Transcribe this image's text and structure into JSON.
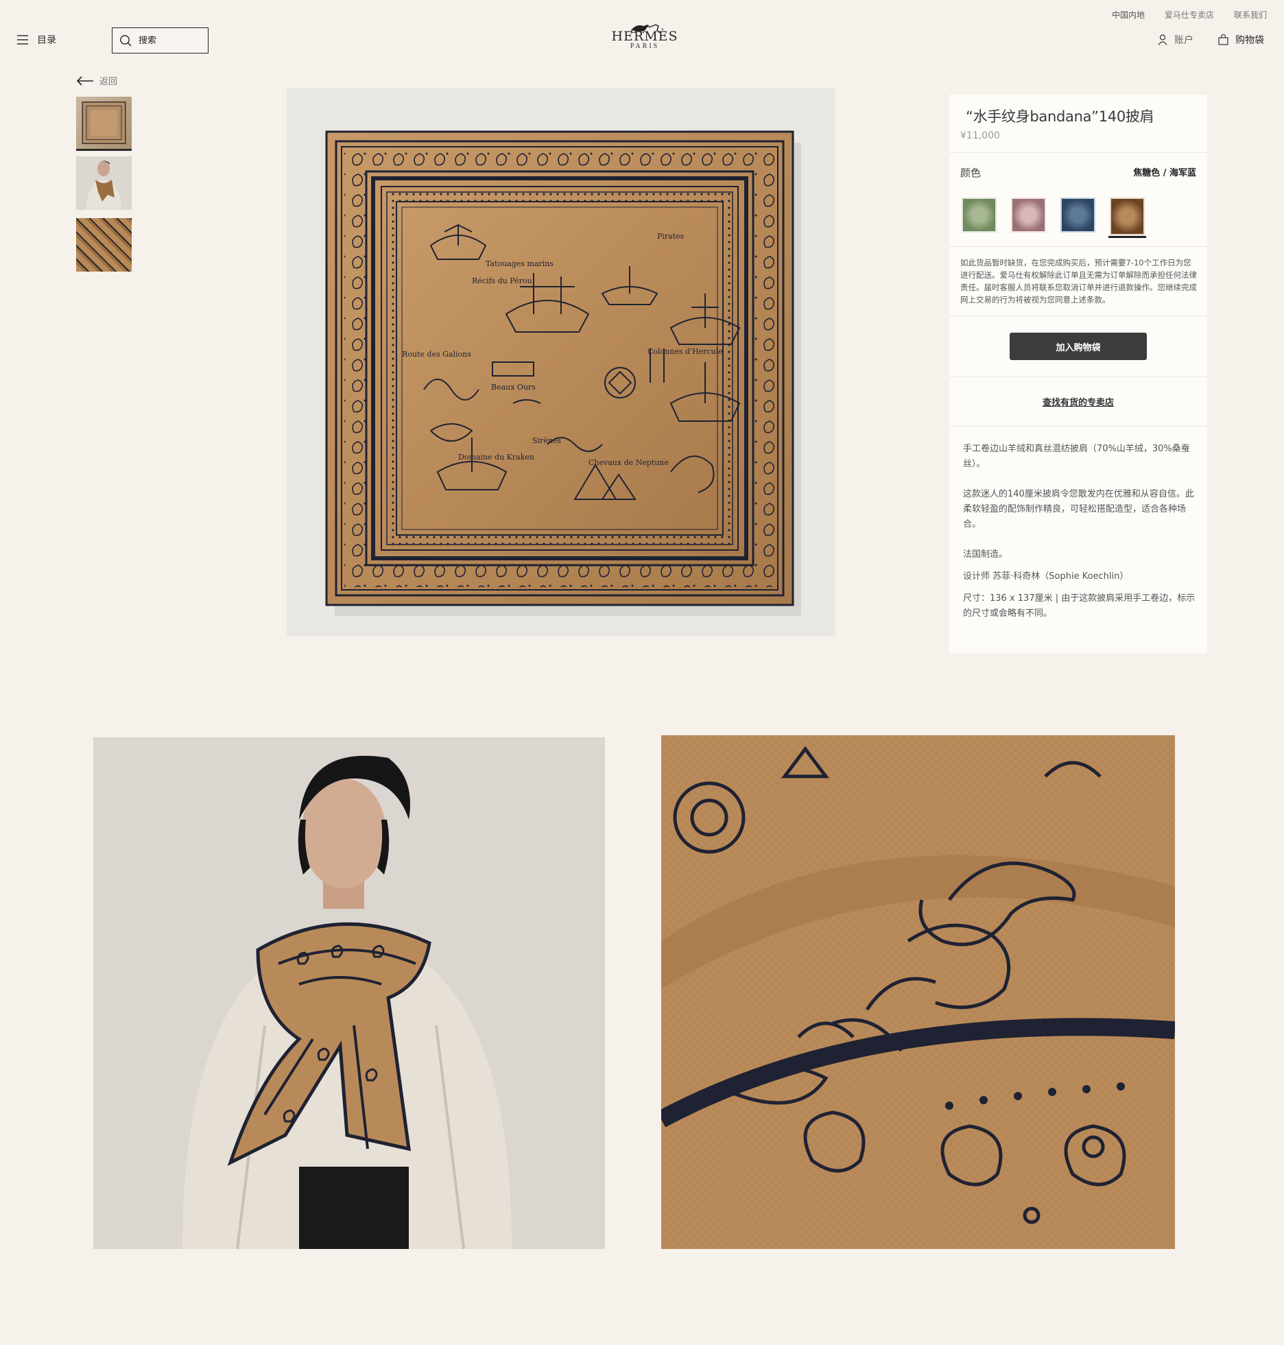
{
  "top_links": [
    "中国内地",
    "爱马仕专卖店",
    "联系我们"
  ],
  "header": {
    "menu_label": "目录",
    "search_placeholder": "搜索",
    "logo_word": "HERMÈS",
    "logo_sub": "PARIS",
    "account_label": "账户",
    "bag_label": "购物袋"
  },
  "nav": {
    "back_label": "返回"
  },
  "product": {
    "title": "“水手纹身bandana”140披肩",
    "price": "¥11,000",
    "color_label": "颜色",
    "color_value": "焦糖色 / 海军蓝",
    "swatch_colors": [
      "#8aa07a",
      "#b89396",
      "#3d5672",
      "#7a5534"
    ],
    "notice": "如此货品暂时缺货，在您完成购买后，预计需要7-10个工作日为您进行配送。爱马仕有权解除此订单且无需为订单解除而承担任何法律责任。届时客服人员将联系您取消订单并进行退款操作。您继续完成网上交易的行为将被视为您同意上述条款。",
    "add_to_cart": "加入购物袋",
    "find_store": "查找有货的专卖店",
    "desc_1": "手工卷边山羊绒和真丝混纺披肩（70%山羊绒，30%桑蚕丝）。",
    "desc_2": "这款迷人的140厘米披肩令您散发内在优雅和从容自信。此柔软轻盈的配饰制作精良，可轻松搭配造型，适合各种场合。",
    "desc_3": "法国制造。",
    "desc_4": "设计师 苏菲·科奇林（Sophie Koechlin）",
    "desc_5": "尺寸：136 x 137厘米 | 由于这款披肩采用手工卷边，标示的尺寸或会略有不同。"
  },
  "scarf_labels": [
    "Tatouages marins",
    "Pirates",
    "Récifs du Pérou",
    "Route des Galions",
    "Colonnes d'Hercule",
    "Beaux Ours",
    "Sirènes",
    "Domaine du Kraken",
    "Chevaux de Neptune"
  ],
  "colors": {
    "background": "#f6f1eb",
    "scarf_base": "#b98a59",
    "navy": "#1f2232",
    "button": "#3c3c3c"
  }
}
